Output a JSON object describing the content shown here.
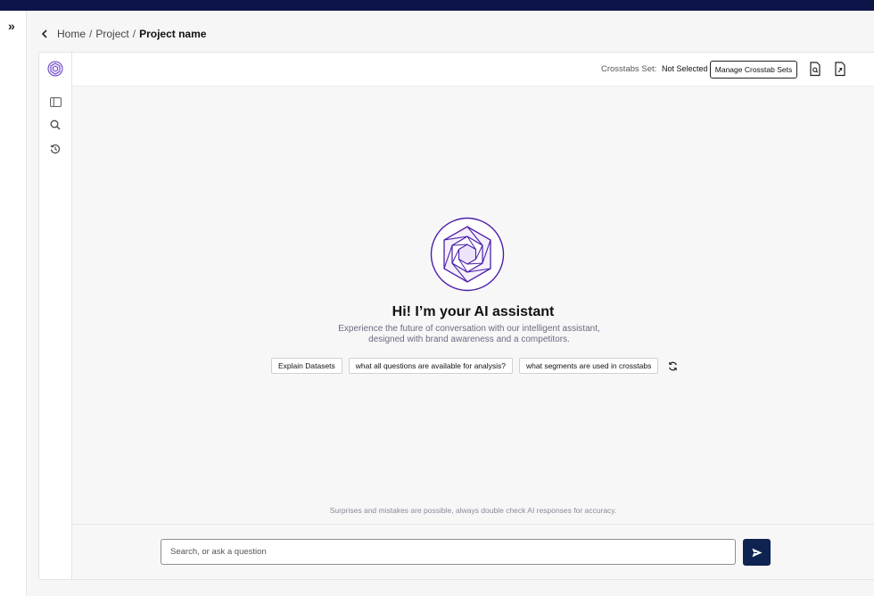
{
  "breadcrumb": {
    "items": [
      "Home",
      "Project"
    ],
    "separator": "/",
    "current": "Project name"
  },
  "header": {
    "crosstabs_label": "Crosstabs Set:",
    "crosstabs_value": "Not Selected",
    "manage_button": "Manage Crosstab Sets",
    "icons": [
      "document-search-icon",
      "document-export-icon"
    ]
  },
  "sidebar": {
    "icons": [
      "assistant-logo-icon",
      "sidebar-panel-icon",
      "search-icon",
      "history-icon"
    ]
  },
  "assistant": {
    "greeting": "Hi! I’m your AI assistant",
    "subtitle_line1": "Experience the future of conversation with our intelligent assistant,",
    "subtitle_line2": "designed with brand awareness and a competitors.",
    "suggestions": [
      "Explain Datasets",
      "what all questions are available for analysis?",
      "what segments are used in crosstabs"
    ],
    "disclaimer": "Surprises and mistakes are possible, always double check AI responses for accuracy."
  },
  "input": {
    "placeholder": "Search, or ask a question",
    "value": ""
  },
  "colors": {
    "topbar": "#0d1548",
    "accent": "#4b1fa8",
    "send_button": "#0f2350"
  }
}
